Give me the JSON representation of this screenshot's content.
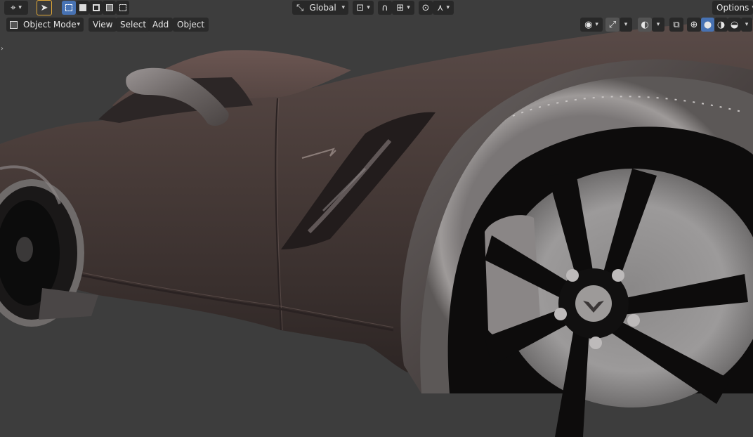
{
  "header": {
    "transform_orientation": "Global",
    "options_label": "Options"
  },
  "view_header": {
    "mode_label": "Object Mode",
    "menus": [
      "View",
      "Select",
      "Add",
      "Object"
    ]
  },
  "icons": {
    "editor_type": "editor-type-icon",
    "select_tool": "cursor-icon",
    "select_modes": [
      "select-new-icon",
      "select-extend-icon",
      "select-subtract-icon",
      "select-invert-icon",
      "select-intersect-icon"
    ],
    "pivot": "pivot-point-icon",
    "snap": "magnet-icon",
    "snap_target": "snap-increment-icon",
    "proportional": "proportional-edit-icon",
    "falloff": "falloff-curve-icon",
    "visibility": "eye-icon",
    "gizmo": "gizmo-icon",
    "overlays": "overlays-icon",
    "xray": "xray-icon",
    "shading": [
      "wireframe-icon",
      "solid-icon",
      "material-preview-icon",
      "rendered-icon"
    ]
  },
  "colors": {
    "background": "#3d3d3d",
    "active_button": "#4772b3",
    "header_bg": "#282828",
    "car_paint": "#3e3230"
  }
}
